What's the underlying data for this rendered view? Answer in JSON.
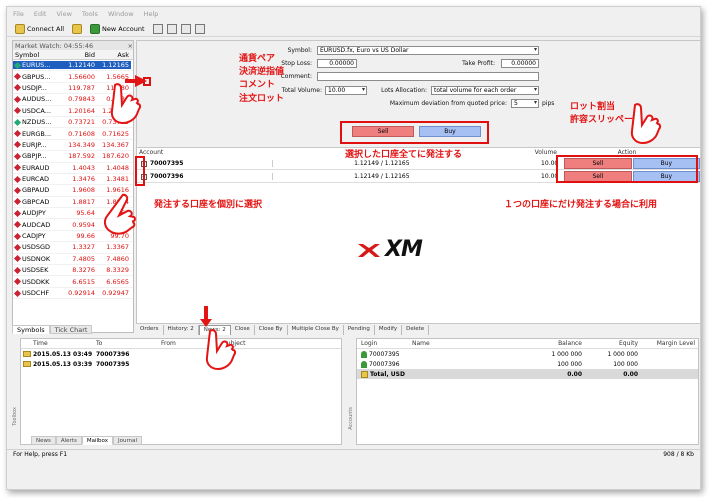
{
  "menu": [
    "File",
    "Edit",
    "View",
    "Tools",
    "Window",
    "Help"
  ],
  "toolbar": {
    "connect_all": "Connect All",
    "new_account": "New Account"
  },
  "market_watch": {
    "title": "Market Watch: 04:55:46",
    "headers": {
      "symbol": "Symbol",
      "bid": "Bid",
      "ask": "Ask"
    },
    "rows": [
      {
        "symbol": "EURUS...",
        "bid": "1.12140",
        "ask": "1.12165",
        "dir": "up",
        "selected": true
      },
      {
        "symbol": "GBPUS...",
        "bid": "1.56600",
        "ask": "1.5665",
        "dir": "down"
      },
      {
        "symbol": "USDJP...",
        "bid": "119.787",
        "ask": "119.80",
        "dir": "down"
      },
      {
        "symbol": "AUDUS...",
        "bid": "0.79843",
        "ask": "0.7986",
        "dir": "down"
      },
      {
        "symbol": "USDCA...",
        "bid": "1.20164",
        "ask": "1.20182",
        "dir": "down"
      },
      {
        "symbol": "NZDUS...",
        "bid": "0.73721",
        "ask": "0.73739",
        "dir": "up"
      },
      {
        "symbol": "EURGB...",
        "bid": "0.71608",
        "ask": "0.71625",
        "dir": "down"
      },
      {
        "symbol": "EURJP...",
        "bid": "134.349",
        "ask": "134.367",
        "dir": "down"
      },
      {
        "symbol": "GBPJP...",
        "bid": "187.592",
        "ask": "187.620",
        "dir": "down"
      },
      {
        "symbol": "EURAUD",
        "bid": "1.4043",
        "ask": "1.4048",
        "dir": "down"
      },
      {
        "symbol": "EURCAD",
        "bid": "1.3476",
        "ask": "1.3481",
        "dir": "down"
      },
      {
        "symbol": "GBPAUD",
        "bid": "1.9608",
        "ask": "1.9616",
        "dir": "down"
      },
      {
        "symbol": "GBPCAD",
        "bid": "1.8817",
        "ask": "1.8824",
        "dir": "down"
      },
      {
        "symbol": "AUDJPY",
        "bid": "95.64",
        "ask": "95.67",
        "dir": "down"
      },
      {
        "symbol": "AUDCAD",
        "bid": "0.9594",
        "ask": "0.9599",
        "dir": "down"
      },
      {
        "symbol": "CADJPY",
        "bid": "99.66",
        "ask": "99.70",
        "dir": "down"
      },
      {
        "symbol": "USDSGD",
        "bid": "1.3327",
        "ask": "1.3367",
        "dir": "down"
      },
      {
        "symbol": "USDNOK",
        "bid": "7.4805",
        "ask": "7.4860",
        "dir": "down"
      },
      {
        "symbol": "USDSEK",
        "bid": "8.3276",
        "ask": "8.3329",
        "dir": "down"
      },
      {
        "symbol": "USDDKK",
        "bid": "6.6515",
        "ask": "6.6565",
        "dir": "down"
      },
      {
        "symbol": "USDCHF",
        "bid": "0.92914",
        "ask": "0.92947",
        "dir": "down"
      }
    ],
    "tabs": [
      "Symbols",
      "Tick Chart"
    ]
  },
  "order_form": {
    "symbol_label": "Symbol:",
    "symbol_value": "EURUSD.fx, Euro vs US Dollar",
    "stop_loss_label": "Stop Loss:",
    "stop_loss_value": "0.00000",
    "take_profit_label": "Take Profit:",
    "take_profit_value": "0.00000",
    "comment_label": "Comment:",
    "total_volume_label": "Total Volume:",
    "total_volume_value": "10.00",
    "lots_allocation_label": "Lots Allocation:",
    "lots_allocation_value": "total volume for each order",
    "max_deviation_label": "Maximum deviation from quoted price:",
    "max_deviation_value": "5",
    "pips": "pips",
    "sell": "Sell",
    "buy": "Buy"
  },
  "accounts": {
    "headers": {
      "account": "Account",
      "volume": "Volume",
      "action": "Action"
    },
    "rows": [
      {
        "id": "70007395",
        "quote": "1.12149 / 1.12165",
        "volume": "10.00",
        "sell": "Sell",
        "buy": "Buy"
      },
      {
        "id": "70007396",
        "quote": "1.12149 / 1.12165",
        "volume": "10.00",
        "sell": "Sell",
        "buy": "Buy"
      }
    ]
  },
  "logo": "XM",
  "bottom_tabs": [
    "Orders",
    "History: 2",
    "News: 2",
    "Close",
    "Close By",
    "Multiple Close By",
    "Pending",
    "Modify",
    "Delete"
  ],
  "news": {
    "headers": {
      "time": "Time",
      "to": "To",
      "from": "From",
      "subject": "Subject"
    },
    "rows": [
      {
        "time": "2015.05.13 03:49",
        "to": "70007396"
      },
      {
        "time": "2015.05.13 03:39",
        "to": "70007395"
      }
    ],
    "tabs": [
      "News",
      "Alerts",
      "Mailbox",
      "Journal"
    ],
    "side_label": "Toolbox"
  },
  "balances": {
    "headers": {
      "login": "Login",
      "name": "Name",
      "balance": "Balance",
      "equity": "Equity",
      "margin": "Margin Level"
    },
    "rows": [
      {
        "login": "70007395",
        "balance": "1 000 000",
        "equity": "1 000 000"
      },
      {
        "login": "70007396",
        "balance": "100 000",
        "equity": "100 000"
      }
    ],
    "total": {
      "login": "Total, USD",
      "balance": "0.00",
      "equity": "0.00"
    },
    "side_label": "Accounts"
  },
  "status": {
    "left": "For Help, press F1",
    "right": "908 / 8 Kb"
  },
  "annotations": {
    "top_labels": [
      "通貨ペア",
      "決済逆指値",
      "コメント",
      "注文ロット"
    ],
    "lot_split": "ロット割当",
    "slippage": "許容スリッページ",
    "all_accounts": "選択した口座全てに発注する",
    "select_accounts": "発注する口座を個別に選択",
    "single_account": "１つの口座にだけ発注する場合に利用"
  },
  "colors": {
    "annotation_red": "#e31414",
    "sell": "#ef7f7f",
    "buy": "#a7c0f3",
    "selection": "#1f5fbf"
  }
}
